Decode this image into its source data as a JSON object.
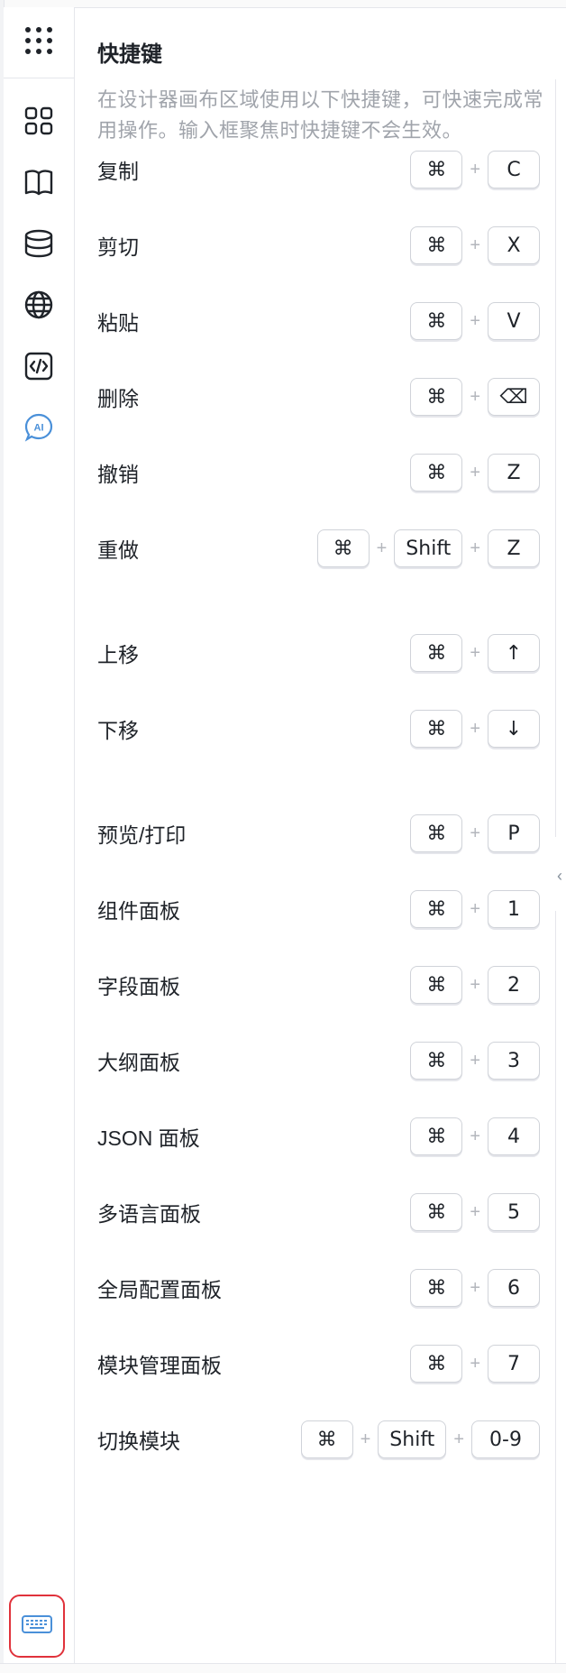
{
  "sidebar": {
    "top_icon": "dots-grid-icon",
    "items": [
      {
        "icon": "components-icon"
      },
      {
        "icon": "book-icon"
      },
      {
        "icon": "database-icon"
      },
      {
        "icon": "globe-icon"
      },
      {
        "icon": "code-icon"
      },
      {
        "icon": "ai-icon",
        "label": "AI"
      }
    ],
    "bottom_icon": "keyboard-icon",
    "accent_color": "#4a90d9",
    "highlight_color": "#e0323b"
  },
  "panel": {
    "title": "快捷键",
    "description": "在设计器画布区域使用以下快捷键，可快速完成常用操作。输入框聚焦时快捷键不会生效。"
  },
  "shortcuts": [
    {
      "label": "复制",
      "keys": [
        "⌘",
        "C"
      ]
    },
    {
      "label": "剪切",
      "keys": [
        "⌘",
        "X"
      ]
    },
    {
      "label": "粘贴",
      "keys": [
        "⌘",
        "V"
      ]
    },
    {
      "label": "删除",
      "keys": [
        "⌘",
        "⌫"
      ]
    },
    {
      "label": "撤销",
      "keys": [
        "⌘",
        "Z"
      ]
    },
    {
      "label": "重做",
      "keys": [
        "⌘",
        "Shift",
        "Z"
      ]
    },
    {
      "label": "上移",
      "keys": [
        "⌘",
        "↑"
      ]
    },
    {
      "label": "下移",
      "keys": [
        "⌘",
        "↓"
      ]
    },
    {
      "label": "预览/打印",
      "keys": [
        "⌘",
        "P"
      ]
    },
    {
      "label": "组件面板",
      "keys": [
        "⌘",
        "1"
      ]
    },
    {
      "label": "字段面板",
      "keys": [
        "⌘",
        "2"
      ]
    },
    {
      "label": "大纲面板",
      "keys": [
        "⌘",
        "3"
      ]
    },
    {
      "label": "JSON 面板",
      "keys": [
        "⌘",
        "4"
      ]
    },
    {
      "label": "多语言面板",
      "keys": [
        "⌘",
        "5"
      ]
    },
    {
      "label": "全局配置面板",
      "keys": [
        "⌘",
        "6"
      ]
    },
    {
      "label": "模块管理面板",
      "keys": [
        "⌘",
        "7"
      ]
    },
    {
      "label": "切换模块",
      "keys": [
        "⌘",
        "Shift",
        "0-9"
      ]
    }
  ],
  "plus_sign": "+"
}
